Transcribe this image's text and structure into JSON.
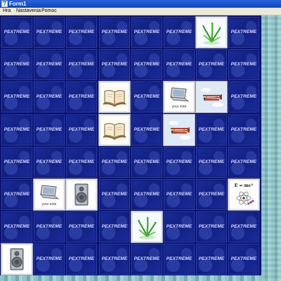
{
  "window": {
    "title": "Form1",
    "app_icon": "delphi-7-icon"
  },
  "menu": {
    "items": [
      "Hra",
      "Nastavenia",
      "Pomoc"
    ]
  },
  "board": {
    "rows": 8,
    "cols": 8,
    "card_back_text": "PEXTREME",
    "face_up_cards": [
      {
        "row": 0,
        "col": 6,
        "picture": "grass-sprout"
      },
      {
        "row": 2,
        "col": 3,
        "picture": "open-book"
      },
      {
        "row": 2,
        "col": 5,
        "picture": "laptop",
        "caption": "your note"
      },
      {
        "row": 2,
        "col": 6,
        "picture": "biplane"
      },
      {
        "row": 3,
        "col": 3,
        "picture": "open-book"
      },
      {
        "row": 3,
        "col": 5,
        "picture": "biplane"
      },
      {
        "row": 5,
        "col": 1,
        "picture": "laptop",
        "caption": "your note"
      },
      {
        "row": 5,
        "col": 2,
        "picture": "speaker"
      },
      {
        "row": 5,
        "col": 7,
        "picture": "einstein-formula",
        "caption": "E = mc²"
      },
      {
        "row": 6,
        "col": 4,
        "picture": "grass-sprout"
      },
      {
        "row": 7,
        "col": 0,
        "picture": "speaker"
      }
    ]
  },
  "colors": {
    "card_back": "#122082",
    "card_face": "#ffffff",
    "title_bar": "#0a44c6",
    "menu_bar": "#ece9d8"
  }
}
